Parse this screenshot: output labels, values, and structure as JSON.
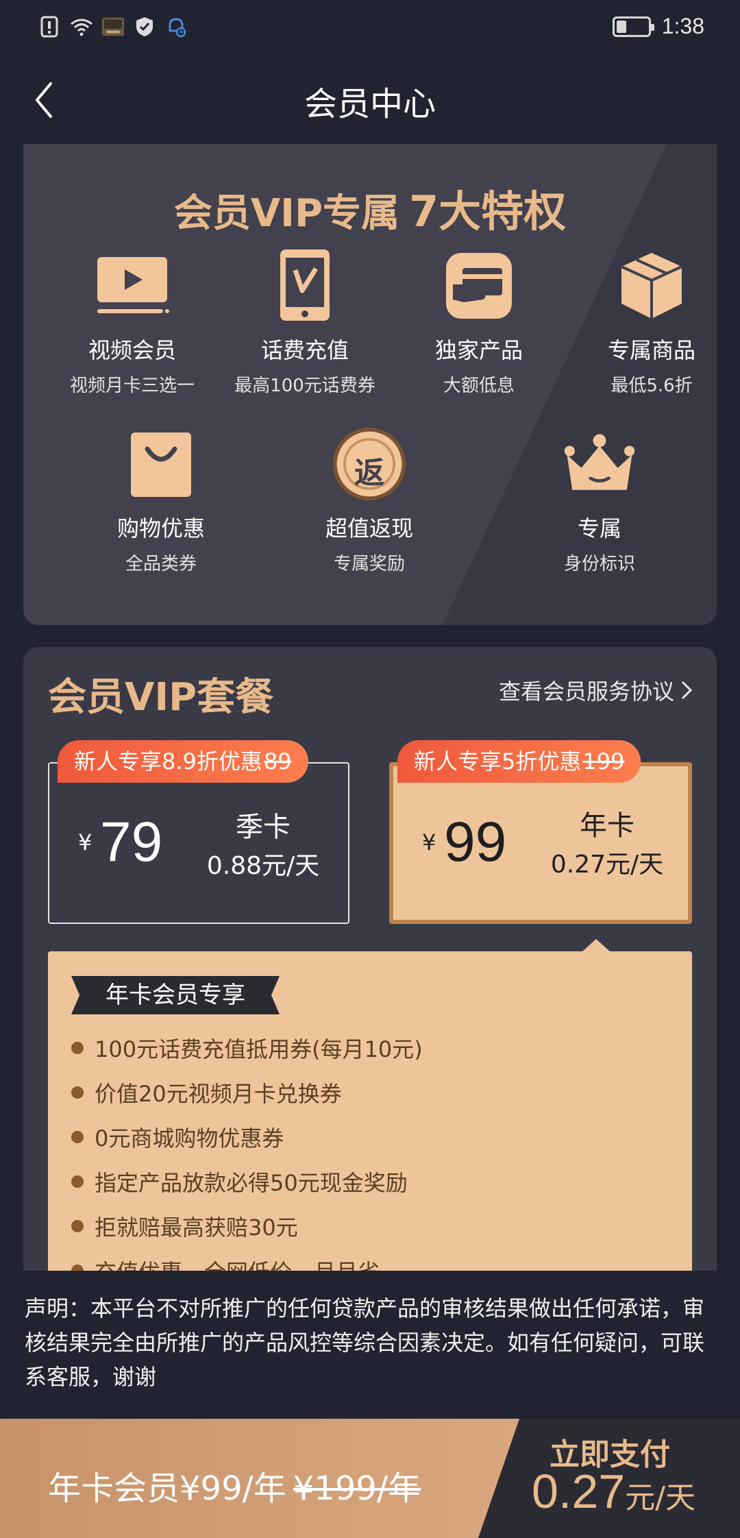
{
  "status_bar": {
    "time": "1:38"
  },
  "header": {
    "title": "会员中心"
  },
  "privileges": {
    "title_main": "会员VIP专属",
    "title_highlight": "7大特权",
    "items": [
      {
        "icon": "video-play-icon",
        "name": "视频会员",
        "sub": "视频月卡三选一"
      },
      {
        "icon": "phone-recharge-icon",
        "name": "话费充值",
        "sub": "最高100元话费券"
      },
      {
        "icon": "card-hand-icon",
        "name": "独家产品",
        "sub": "大额低息"
      },
      {
        "icon": "box-icon",
        "name": "专属商品",
        "sub": "最低5.6折"
      },
      {
        "icon": "shopping-bag-icon",
        "name": "购物优惠",
        "sub": "全品类券"
      },
      {
        "icon": "cashback-coin-icon",
        "name": "超值返现",
        "sub": "专属奖励",
        "glyph": "返"
      },
      {
        "icon": "crown-icon",
        "name": "专属",
        "sub": "身份标识"
      }
    ]
  },
  "plans": {
    "title": "会员VIP套餐",
    "agreement_link": "查看会员服务协议",
    "options": [
      {
        "badge": "新人专享8.9折优惠",
        "old_price": "89",
        "currency": "¥",
        "price": "79",
        "name": "季卡",
        "per_day": "0.88元/天",
        "selected": false
      },
      {
        "badge": "新人专享5折优惠",
        "old_price": "199",
        "currency": "¥",
        "price": "99",
        "name": "年卡",
        "per_day": "0.27元/天",
        "selected": true
      }
    ],
    "detail": {
      "tag": "年卡会员专享",
      "items": [
        "100元话费充值抵用券(每月10元)",
        "价值20元视频月卡兑换券",
        "0元商城购物优惠券",
        "指定产品放款必得50元现金奖励",
        "拒就赔最高获赔30元",
        "充值优惠，全网低价，月月省"
      ]
    }
  },
  "disclaimer": "声明：本平台不对所推广的任何贷款产品的审核结果做出任何承诺，审核结果完全由所推广的产品风控等综合因素决定。如有任何疑问，可联系客服，谢谢",
  "bottom_bar": {
    "summary": "年卡会员¥99/年",
    "summary_old": "¥199/年",
    "pay_label": "立即支付",
    "pay_price": "0.27",
    "pay_unit": "元/天"
  },
  "colors": {
    "gold": "#e8b98a",
    "bg": "#222330",
    "card": "#42414d",
    "badge_red": "#f0593b"
  }
}
